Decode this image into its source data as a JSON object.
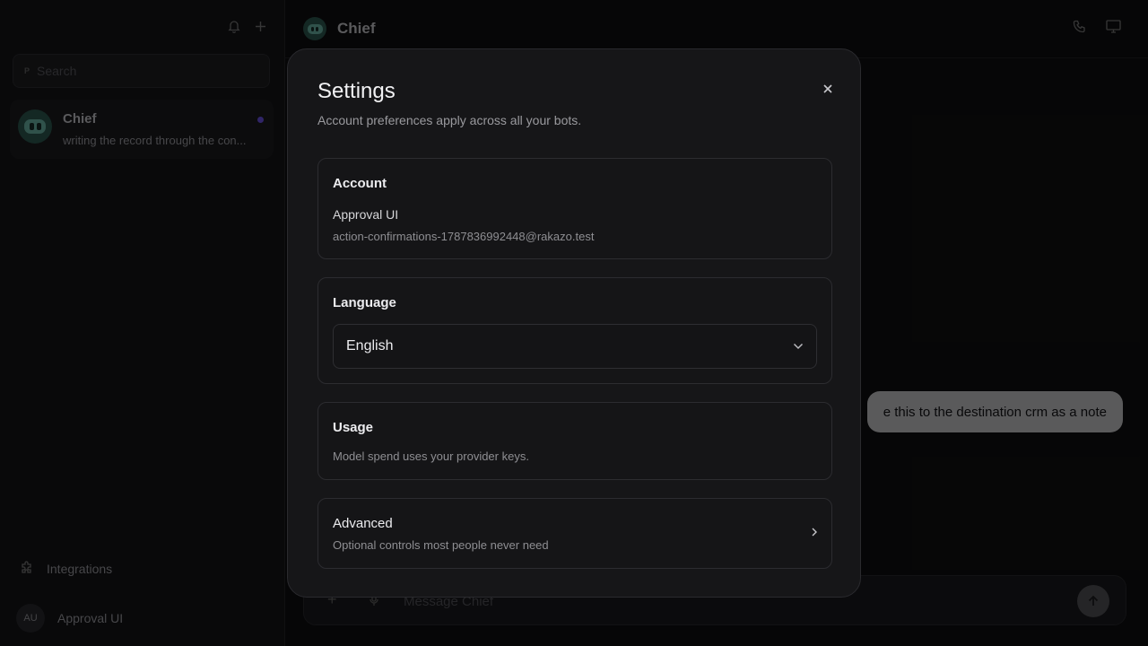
{
  "sidebar": {
    "search_placeholder": "Search",
    "search_icon_glyph": "P",
    "chats": [
      {
        "name": "Chief",
        "preview": "writing the record through the con..."
      }
    ],
    "integrations_label": "Integrations",
    "user": {
      "initials": "AU",
      "name": "Approval UI"
    }
  },
  "main": {
    "title": "Chief",
    "message_bubble": "e this to the destination crm as a note",
    "composer_placeholder": "Message Chief"
  },
  "settings": {
    "title": "Settings",
    "subtitle": "Account preferences apply across all your bots.",
    "account": {
      "label": "Account",
      "name": "Approval UI",
      "email": "action-confirmations-1787836992448@rakazo.test"
    },
    "language": {
      "label": "Language",
      "selected": "English"
    },
    "usage": {
      "label": "Usage",
      "description": "Model spend uses your provider keys."
    },
    "advanced": {
      "label": "Advanced",
      "description": "Optional controls most people never need"
    }
  },
  "colors": {
    "accent_dot": "#4a3aa0",
    "bot_avatar": "#1f3e38"
  }
}
